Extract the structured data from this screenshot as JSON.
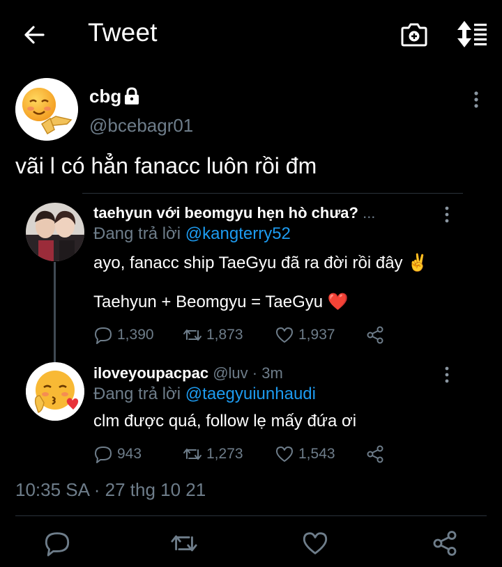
{
  "header": {
    "title": "Tweet",
    "icons": [
      "back-arrow-icon",
      "camera-icon",
      "sort-icon"
    ]
  },
  "tweet": {
    "name": "cbg",
    "handle": "@bcebagr01",
    "text": "vãi l có hẳn fanacc luôn rồi đm",
    "timestamp": "10:35 SA · 27 thg 10 21"
  },
  "replies": [
    {
      "name": "taehyun với beomgyu hẹn hò chưa?",
      "name_suffix": "...",
      "replying_prefix": "Đang trả lời ",
      "replying_to": "@kangterry52",
      "lines": [
        "ayo, fanacc ship TaeGyu đã ra đời rồi đây ✌️",
        "Taehyun + Beomgyu = TaeGyu ❤️"
      ],
      "stats": {
        "replies": "1,390",
        "retweets": "1,873",
        "likes": "1,937"
      }
    },
    {
      "name": "iloveyoupacpac",
      "meta": "@luv · 3m",
      "replying_prefix": "Đang trả lời ",
      "replying_to": "@taegyuiunhaudi",
      "lines": [
        "clm được quá, follow lẹ mấy đứa ơi"
      ],
      "stats": {
        "replies": "943",
        "retweets": "1,273",
        "likes": "1,543"
      }
    }
  ],
  "colors": {
    "background": "#000000",
    "muted": "#6e7d8a",
    "link": "#1d9bf0",
    "heart": "#e0245e"
  }
}
